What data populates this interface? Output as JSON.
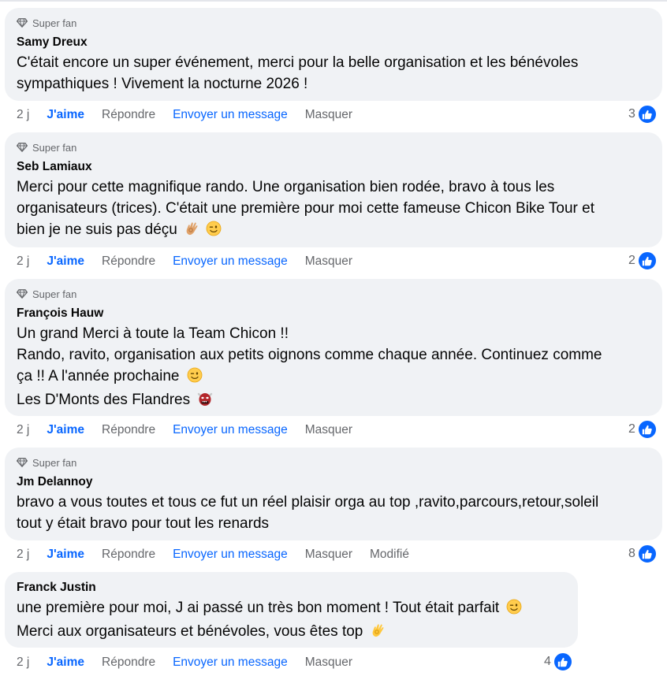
{
  "labels": {
    "badge": "Super fan",
    "time": "2 j",
    "like": "J'aime",
    "reply": "Répondre",
    "message": "Envoyer un message",
    "hide": "Masquer",
    "edited": "Modifié"
  },
  "colors": {
    "bubble": "#f0f2f5",
    "accent": "#0866ff",
    "muted": "#65676b",
    "text": "#050505"
  },
  "icons": {
    "badge": "diamond-icon",
    "reaction": "thumbs-up-icon",
    "emoji_ok": "ok-hand-emoji",
    "emoji_wink": "winking-face-emoji",
    "emoji_ogre": "ogre-emoji"
  },
  "comments": [
    {
      "author": "Samy Dreux",
      "badge": "Super fan",
      "lines": [
        "C'était encore un super événement, merci pour la belle organisation et les bénévoles",
        "sympathiques ! Vivement la nocturne 2026 !"
      ],
      "reactions": "3",
      "edited": ""
    },
    {
      "author": "Seb Lamiaux",
      "badge": "Super fan",
      "lines": [
        "Merci pour cette magnifique rando. Une organisation bien rodée, bravo à tous les",
        "organisateurs (trices). C'était une première pour moi cette fameuse Chicon Bike Tour et",
        "bien je ne suis pas déçu"
      ],
      "reactions": "2",
      "edited": ""
    },
    {
      "author": "François Hauw",
      "badge": "Super fan",
      "lines": [
        "Un grand Merci à toute la Team Chicon !!",
        "Rando, ravito, organisation aux petits oignons comme chaque année. Continuez comme",
        "ça !! A l'année prochaine",
        "Les D'Monts des Flandres"
      ],
      "reactions": "2",
      "edited": ""
    },
    {
      "author": "Jm Delannoy",
      "badge": "Super fan",
      "lines": [
        "bravo a vous toutes et tous ce fut un réel plaisir orga au top ,ravito,parcours,retour,soleil",
        "tout y était bravo pour tout les renards"
      ],
      "reactions": "8",
      "edited": "Modifié"
    },
    {
      "author": "Franck Justin",
      "badge": "",
      "lines": [
        "une première pour moi, J ai passé un très bon moment ! Tout était parfait",
        "Merci aux organisateurs et bénévoles, vous êtes top"
      ],
      "reactions": "4",
      "edited": ""
    }
  ]
}
